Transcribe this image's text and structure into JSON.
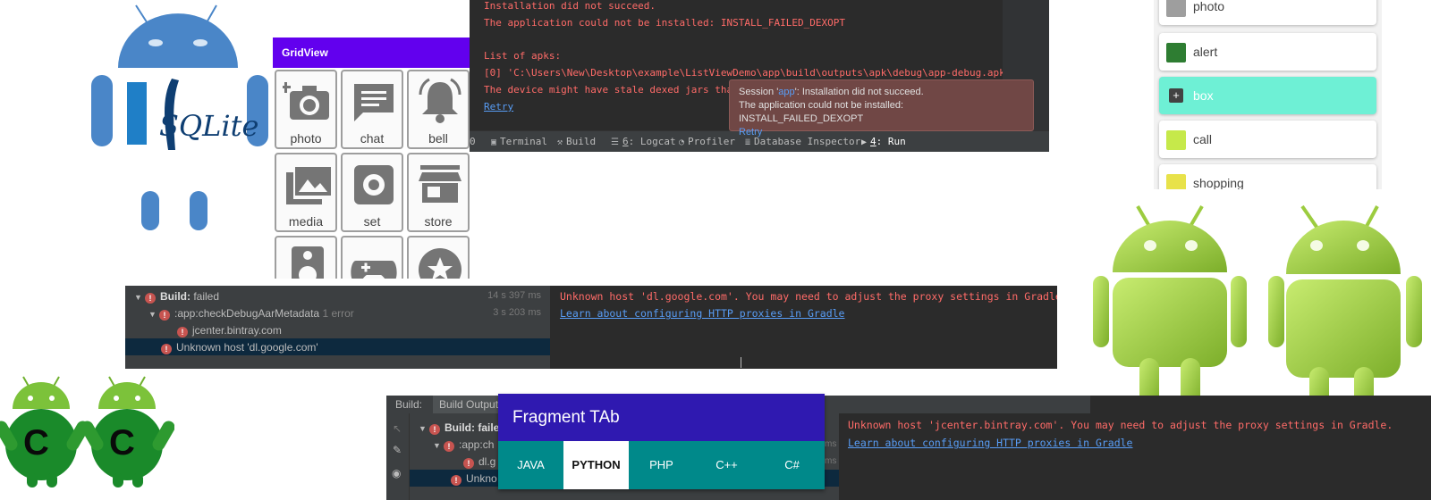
{
  "sqlite_logo": {
    "text": "SQLite"
  },
  "gridview": {
    "title": "GridView",
    "cells": [
      {
        "label": "photo",
        "icon": "camera-icon"
      },
      {
        "label": "chat",
        "icon": "chat-icon"
      },
      {
        "label": "bell",
        "icon": "bell-icon"
      },
      {
        "label": "media",
        "icon": "image-icon"
      },
      {
        "label": "set",
        "icon": "gear-icon"
      },
      {
        "label": "store",
        "icon": "store-icon"
      },
      {
        "label": "",
        "icon": "speaker-icon"
      },
      {
        "label": "",
        "icon": "gamepad-icon"
      },
      {
        "label": "",
        "icon": "star-icon"
      }
    ]
  },
  "run_console": {
    "lines": [
      "Installation did not succeed.",
      "The application could not be installed: INSTALL_FAILED_DEXOPT",
      "List of apks:",
      "[0] 'C:\\Users\\New\\Desktop\\example\\ListViewDemo\\app\\build\\outputs\\apk\\debug\\app-debug.apk'",
      "The device might have stale dexed jars tha"
    ],
    "retry": "Retry",
    "tooltip": {
      "line1_pre": "Session '",
      "line1_app": "app",
      "line1_post": "': Installation did not succeed.",
      "line2": "The application could not be installed: INSTALL_FAILED_DEXOPT",
      "retry": "Retry"
    },
    "toolbar": {
      "edge": "0",
      "terminal": "Terminal",
      "build": "Build",
      "logcat_num": "6",
      "logcat": ": Logcat",
      "profiler": "Profiler",
      "database_inspector": "Database Inspector",
      "run_num": "4",
      "run": ": Run"
    }
  },
  "list_widget": {
    "items": [
      {
        "label": "photo",
        "icon_color": "#9e9e9e"
      },
      {
        "label": "alert",
        "icon_color": "#2e7d32"
      },
      {
        "label": "box",
        "icon_color": "#424242"
      },
      {
        "label": "call",
        "icon_color": "#c6e94a"
      },
      {
        "label": "shopping",
        "icon_color": "#e8e24a"
      }
    ]
  },
  "build_panel_1": {
    "tree": [
      {
        "label_bold": "Build:",
        "label": " failed",
        "time": "14 s 397 ms"
      },
      {
        "label_bold": "",
        "label": ":app:checkDebugAarMetadata",
        "extra": " 1 error",
        "time": "3 s 203 ms"
      },
      {
        "label_bold": "",
        "label": "jcenter.bintray.com",
        "time": ""
      },
      {
        "label_bold": "",
        "label": "Unknown host 'dl.google.com'",
        "time": ""
      }
    ],
    "console": [
      "Unknown host 'dl.google.com'. You may need to adjust the proxy settings in Gradle.",
      "Learn about configuring HTTP proxies in Gradle"
    ]
  },
  "build_panel_2": {
    "header_build": "Build:",
    "header_output": "Build Output",
    "tree": [
      "Build: faile",
      ":app:ch",
      "dl.g",
      "Unkno"
    ],
    "time_suffix": "ms",
    "console": [
      "Unknown host 'jcenter.bintray.com'. You may need to adjust the proxy settings in Gradle.",
      "Learn about configuring HTTP proxies in Gradle"
    ]
  },
  "fragment_tab": {
    "title": "Fragment TAb",
    "tabs": [
      "JAVA",
      "PYTHON",
      "PHP",
      "C++",
      "C#"
    ],
    "selected": "PYTHON"
  },
  "cc_droids": {
    "letters": [
      "C",
      "C"
    ]
  },
  "colors": {
    "android_green": "#a4c639",
    "console_error": "#ff6b68",
    "link_blue": "#589df6",
    "gridview_bar": "#6200ee",
    "fragment_bar": "#2f19b0",
    "fragment_tabs": "#00898a"
  }
}
